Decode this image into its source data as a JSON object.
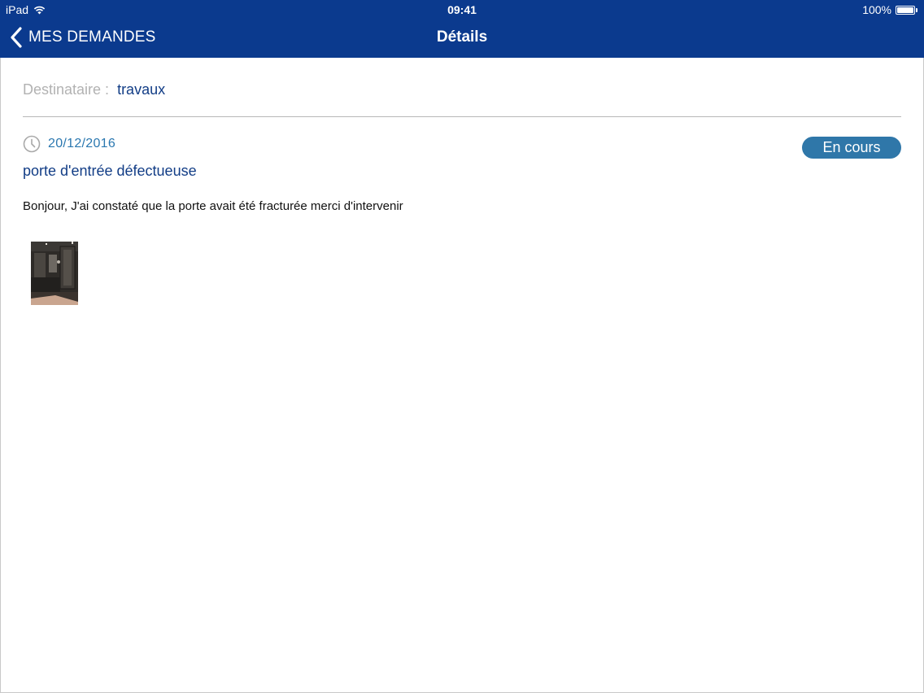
{
  "status_bar": {
    "carrier": "iPad",
    "time": "09:41",
    "battery": "100%"
  },
  "nav": {
    "back_label": "MES DEMANDES",
    "title": "Détails"
  },
  "request": {
    "recipient_label": "Destinataire :",
    "recipient_value": "travaux",
    "date": "20/12/2016",
    "status": "En cours",
    "subject": "porte d'entrée défectueuse",
    "message": "Bonjour, J'ai constaté que la porte avait été fracturée merci d'intervenir"
  },
  "colors": {
    "header_bg": "#0b3a8e",
    "badge_bg": "#2f77a9",
    "title_text": "#123d86",
    "date_text": "#2b78b0"
  },
  "icons": {
    "back": "chevron-left-icon",
    "clock": "clock-icon",
    "wifi": "wifi-icon",
    "battery": "battery-icon"
  }
}
